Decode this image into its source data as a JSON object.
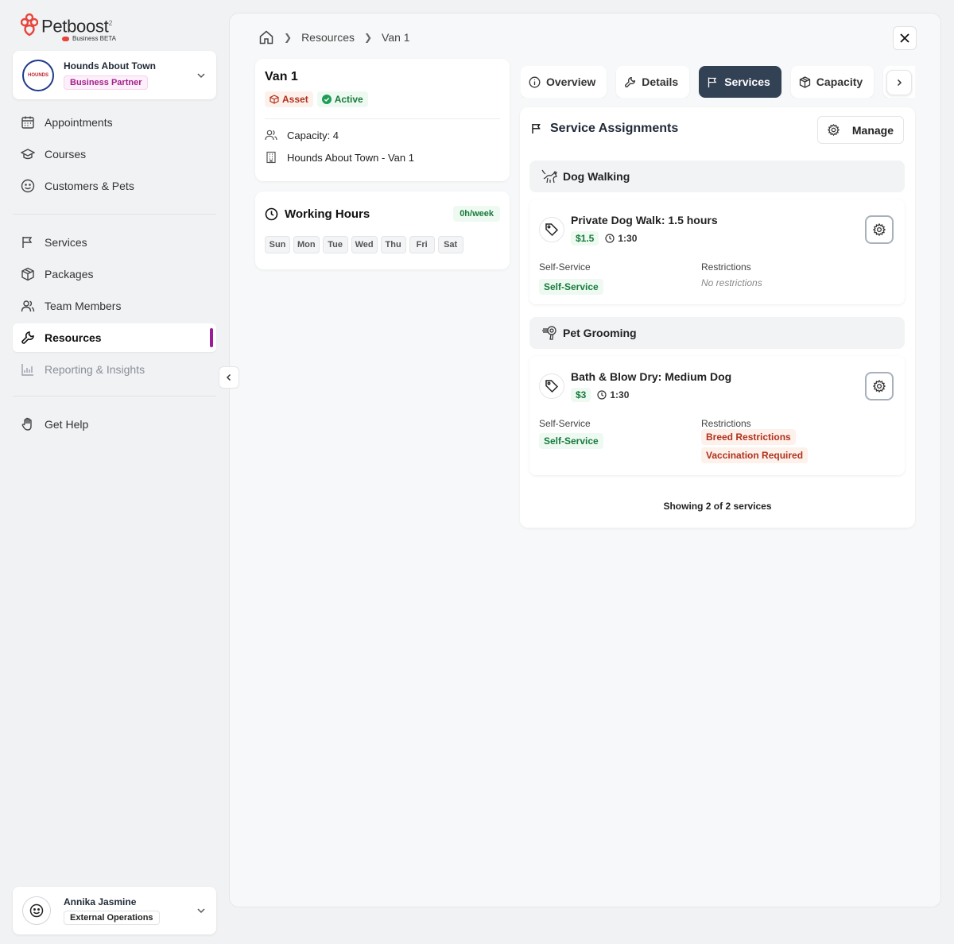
{
  "brand": {
    "name": "Petboost",
    "mark": "2",
    "subtitle": "Business BETA",
    "accent": "#e8453c"
  },
  "business": {
    "name": "Hounds About Town",
    "role": "Business Partner",
    "logo_text": "HOUNDS"
  },
  "nav": {
    "primary": [
      {
        "label": "Appointments",
        "icon": "calendar-icon"
      },
      {
        "label": "Courses",
        "icon": "graduation-cap-icon"
      },
      {
        "label": "Customers & Pets",
        "icon": "smiley-icon"
      }
    ],
    "secondary": [
      {
        "label": "Services",
        "icon": "flag-icon"
      },
      {
        "label": "Packages",
        "icon": "box-icon"
      },
      {
        "label": "Team Members",
        "icon": "users-icon"
      },
      {
        "label": "Resources",
        "icon": "wrench-icon",
        "active": true
      },
      {
        "label": "Reporting & Insights",
        "icon": "chart-icon",
        "disabled": true
      }
    ],
    "help": {
      "label": "Get Help",
      "icon": "hand-icon"
    }
  },
  "user": {
    "name": "Annika Jasmine",
    "role": "External Operations"
  },
  "breadcrumb": {
    "items": [
      "Resources",
      "Van 1"
    ]
  },
  "resource": {
    "title": "Van 1",
    "tags": {
      "asset": "Asset",
      "status": "Active"
    },
    "capacity": "Capacity: 4",
    "location": "Hounds About Town - Van 1"
  },
  "working_hours": {
    "title": "Working Hours",
    "total": "0h/week",
    "days": [
      "Sun",
      "Mon",
      "Tue",
      "Wed",
      "Thu",
      "Fri",
      "Sat"
    ]
  },
  "tabs": {
    "overview": "Overview",
    "details": "Details",
    "services": "Services",
    "capacity": "Capacity",
    "active": "Services"
  },
  "services_panel": {
    "title": "Service Assignments",
    "manage_label": "Manage",
    "groups": [
      {
        "name": "Dog Walking",
        "icon": "dog-icon",
        "services": [
          {
            "name": "Private Dog Walk: 1.5 hours",
            "price": "$1.5",
            "duration": "1:30",
            "self_service_label": "Self-Service",
            "self_service_value": "Self-Service",
            "restrictions_label": "Restrictions",
            "restrictions_none": "No restrictions"
          }
        ]
      },
      {
        "name": "Pet Grooming",
        "icon": "hair-dryer-icon",
        "services": [
          {
            "name": "Bath & Blow Dry: Medium Dog",
            "price": "$3",
            "duration": "1:30",
            "self_service_label": "Self-Service",
            "self_service_value": "Self-Service",
            "restrictions_label": "Restrictions",
            "restrictions": [
              "Breed Restrictions",
              "Vaccination Required"
            ]
          }
        ]
      }
    ],
    "footer": "Showing 2 of 2 services"
  }
}
